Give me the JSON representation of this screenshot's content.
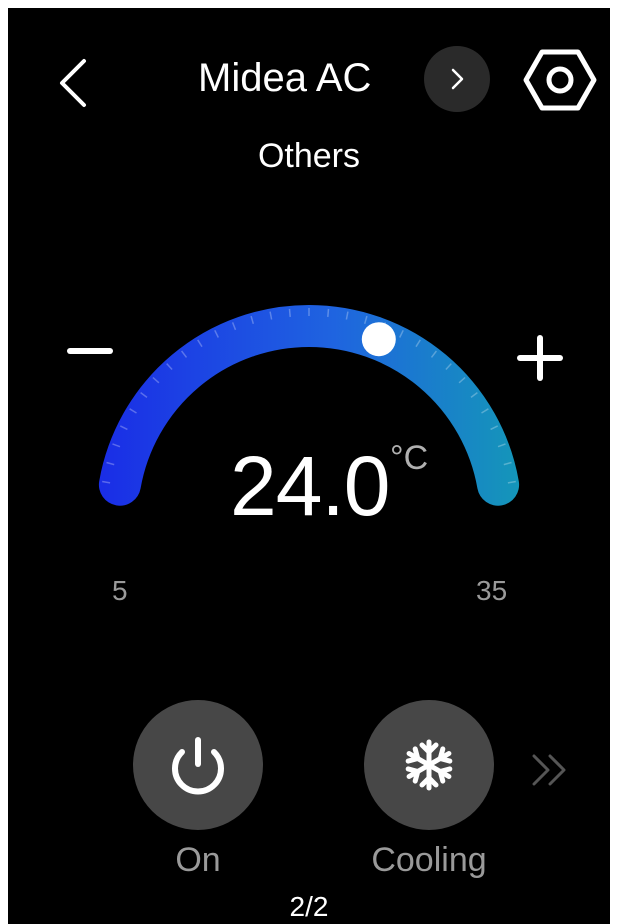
{
  "header": {
    "title": "Midea AC",
    "back_icon": "chevron-left-icon",
    "next_icon": "chevron-right-icon",
    "settings_icon": "hex-gear-icon"
  },
  "room": "Others",
  "thermostat": {
    "temperature": "24.0",
    "unit": "°C",
    "min_label": "5",
    "max_label": "35",
    "min": 5,
    "max": 35,
    "setpoint": 24.0,
    "minus_icon": "minus-icon",
    "plus_icon": "plus-icon",
    "gradient_start": "#1a2ee6",
    "gradient_mid": "#1f64e0",
    "gradient_end": "#1497b8"
  },
  "controls": [
    {
      "label": "On",
      "icon": "power-icon"
    },
    {
      "label": "Cooling",
      "icon": "snowflake-icon"
    }
  ],
  "more_icon": "double-chevron-right-icon",
  "pager": "2/2",
  "colors": {
    "background": "#000000",
    "button_bg": "#474747",
    "muted_text": "#9a9a9a"
  }
}
